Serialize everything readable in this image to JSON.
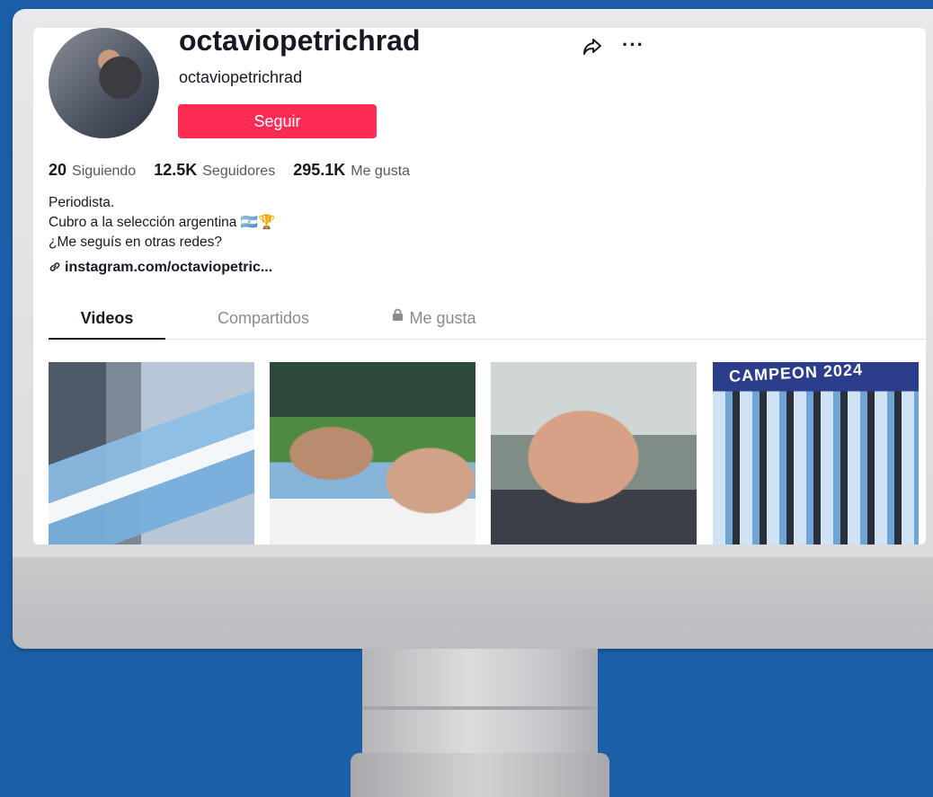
{
  "profile": {
    "username": "octaviopetrichrad",
    "handle": "octaviopetrichrad",
    "follow_label": "Seguir",
    "share_icon": "share-icon",
    "more_icon": "more-icon",
    "more_glyph": "···"
  },
  "stats": [
    {
      "value": "20",
      "label": "Siguiendo"
    },
    {
      "value": "12.5K",
      "label": "Seguidores"
    },
    {
      "value": "295.1K",
      "label": "Me gusta"
    }
  ],
  "bio": {
    "line1": "Periodista.",
    "line2": "Cubro a la selección argentina 🇦🇷🏆",
    "line3": "¿Me seguís en otras redes?"
  },
  "link": {
    "icon": "link-icon",
    "text": "instagram.com/octaviopetric..."
  },
  "tabs": [
    {
      "label": "Videos",
      "active": true
    },
    {
      "label": "Compartidos",
      "active": false
    },
    {
      "label": "Me gusta",
      "active": false,
      "icon": "lock-icon"
    }
  ],
  "videos": [
    {
      "id": 1
    },
    {
      "id": 2
    },
    {
      "id": 3
    },
    {
      "id": 4,
      "overlay_text": "CAMPEON 2024"
    }
  ],
  "colors": {
    "background": "#1b5fa8",
    "follow_button": "#fe2c55"
  }
}
